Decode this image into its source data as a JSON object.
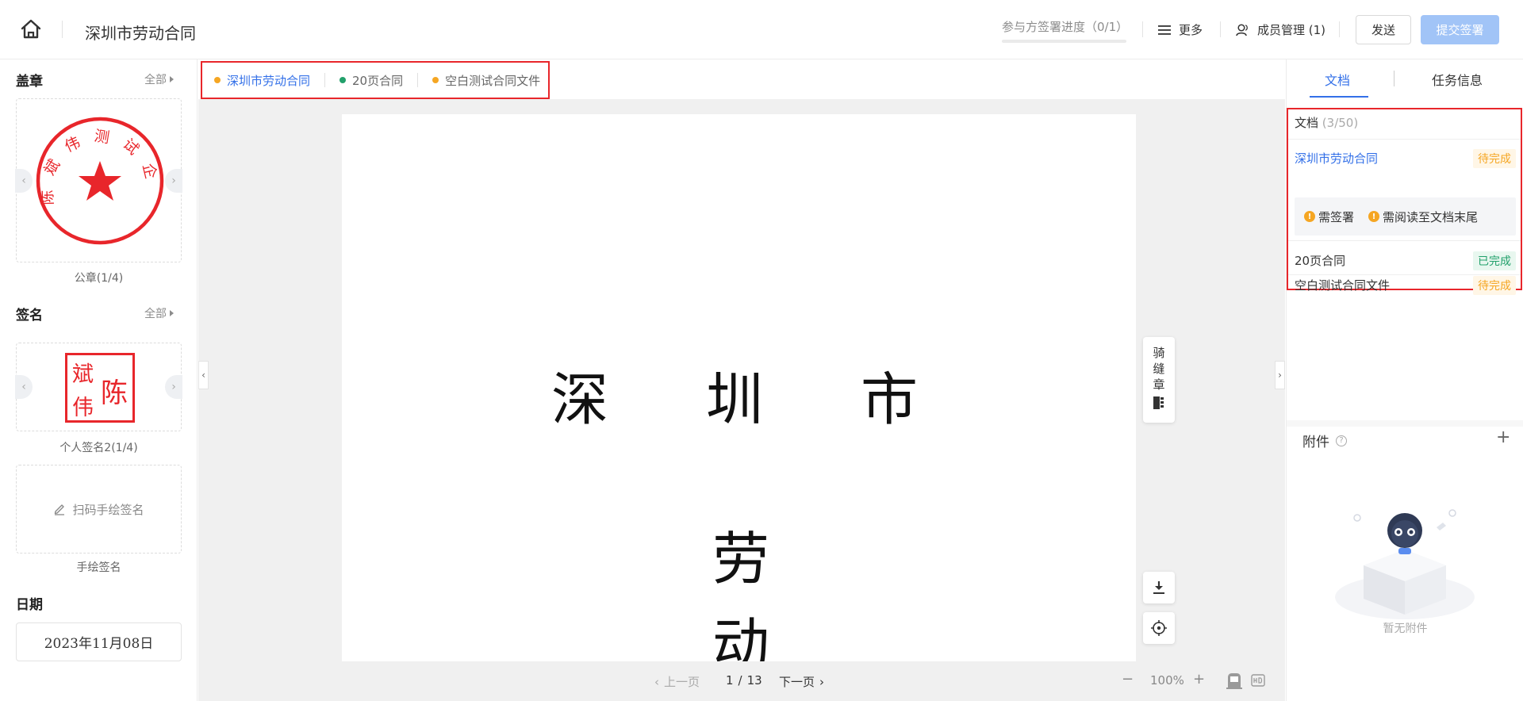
{
  "header": {
    "title": "深圳市劳动合同",
    "progress_label": "参与方签署进度（0/1）",
    "more_label": "更多",
    "members_label": "成员管理 (1)",
    "send_label": "发送",
    "submit_label": "提交签署"
  },
  "left": {
    "seal": {
      "title": "盖章",
      "all_label": "全部",
      "caption": "公章(1/4)",
      "seal_text": "陈斌伟测试企业",
      "colors": {
        "seal_red": "#e8262b"
      }
    },
    "signature": {
      "title": "签名",
      "all_label": "全部",
      "caption": "个人签名2(1/4)",
      "sig_chars": [
        "斌",
        "陈",
        "伟"
      ],
      "handdraw_label": "扫码手绘签名",
      "handdraw_caption": "手绘签名"
    },
    "date": {
      "title": "日期",
      "value": "2023年11月08日"
    }
  },
  "center": {
    "tabs": [
      {
        "label": "深圳市劳动合同",
        "dot_color": "#f5a623",
        "active": true
      },
      {
        "label": "20页合同",
        "dot_color": "#22a06b",
        "active": false
      },
      {
        "label": "空白测试合同文件",
        "dot_color": "#f5a623",
        "active": false
      }
    ],
    "page_chars": [
      "深",
      "圳",
      "市",
      "劳",
      "动"
    ],
    "qifeng_chars": [
      "骑",
      "缝",
      "章"
    ],
    "pager": {
      "prev_label": "上一页",
      "next_label": "下一页",
      "current": "1",
      "total": "13",
      "zoom": "100%"
    }
  },
  "right": {
    "tab_docs": "文档",
    "tab_task": "任务信息",
    "docs_label": "文档",
    "docs_count": "(3/50)",
    "documents": [
      {
        "name": "深圳市劳动合同",
        "status": "待完成"
      },
      {
        "name": "20页合同",
        "status": "已完成"
      },
      {
        "name": "空白测试合同文件",
        "status": "待完成"
      }
    ],
    "requirements": [
      "需签署",
      "需阅读至文档末尾"
    ],
    "attach_title": "附件",
    "empty_text": "暂无附件"
  },
  "colors": {
    "accent": "#3370e8",
    "submit_disabled": "#a1c4f7",
    "pending": "#f5a623",
    "done": "#22a06b",
    "highlight_red": "#e8262b"
  }
}
